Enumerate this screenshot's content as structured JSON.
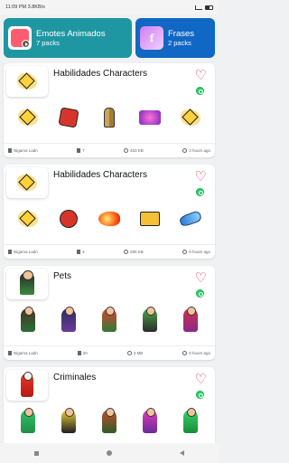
{
  "statusbar": {
    "time": "11:09 PM 3.8KB/s"
  },
  "tiles": [
    {
      "title": "Emotes Animados",
      "subtitle": "7 packs",
      "color": "#1f97a3"
    },
    {
      "title": "Frases",
      "subtitle": "2 packs",
      "color": "#1167c4"
    }
  ],
  "packs": [
    {
      "title": "Habilidades Characters",
      "author": "Nigama Ladn",
      "downloads": "7",
      "size": "453 KB",
      "time": "3 hours ago"
    },
    {
      "title": "Habilidades Characters",
      "author": "Nigama Ladn",
      "downloads": "4",
      "size": "280 KB",
      "time": "6 hours ago"
    },
    {
      "title": "Pets",
      "author": "Nigama Ladn",
      "downloads": "20",
      "size": "3 MB",
      "time": "5 hours ago"
    },
    {
      "title": "Criminales"
    }
  ],
  "colors": {
    "heart": "#e8335a",
    "whatsapp": "#25d366"
  }
}
